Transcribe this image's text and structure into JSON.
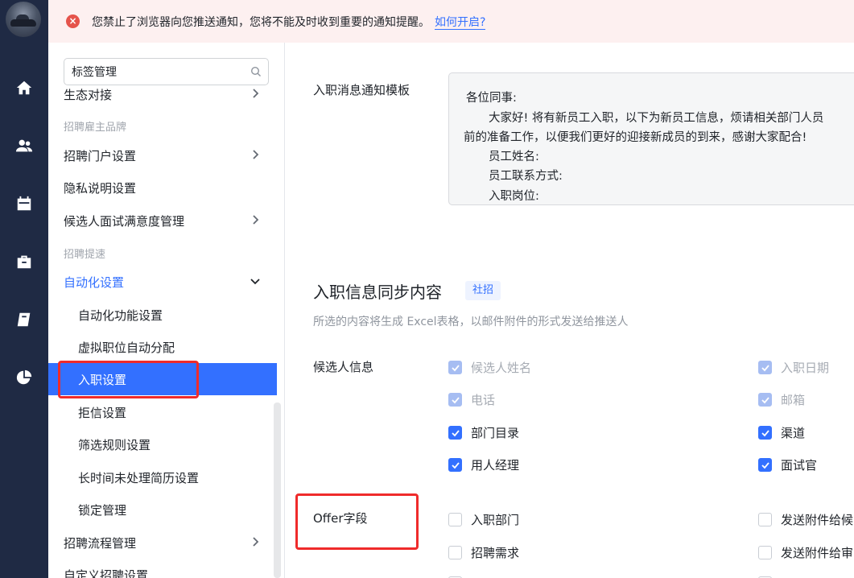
{
  "banner": {
    "message": "您禁止了浏览器向您推送通知，您将不能及时收到重要的通知提醒。",
    "link": "如何开启?"
  },
  "rail": {
    "icons": [
      "home-icon",
      "users-icon",
      "calendar-icon",
      "briefcase-icon",
      "book-icon",
      "pie-chart-icon"
    ]
  },
  "sidebar": {
    "search_value": "标签管理",
    "items": [
      {
        "label": "生态对接"
      },
      {
        "label": "招聘雇主品牌"
      },
      {
        "label": "招聘门户设置"
      },
      {
        "label": "隐私说明设置"
      },
      {
        "label": "候选人面试满意度管理"
      },
      {
        "label": "招聘提速"
      },
      {
        "label": "自动化设置"
      },
      {
        "label": "自动化功能设置"
      },
      {
        "label": "虚拟职位自动分配"
      },
      {
        "label": "入职设置"
      },
      {
        "label": "拒信设置"
      },
      {
        "label": "筛选规则设置"
      },
      {
        "label": "长时间未处理简历设置"
      },
      {
        "label": "锁定管理"
      },
      {
        "label": "招聘流程管理"
      },
      {
        "label": "自定义招聘设置"
      }
    ]
  },
  "main": {
    "template_label": "入职消息通知模板",
    "template_lines": [
      "各位同事:",
      "大家好! 将有新员工入职，以下为新员工信息，烦请相关部门人员",
      "前的准备工作，以便我们更好的迎接新成员的到来，感谢大家配合!",
      "员工姓名:",
      "员工联系方式:",
      "入职岗位:"
    ],
    "section_title": "入职信息同步内容",
    "section_tag": "社招",
    "section_desc": "所选的内容将生成 Excel表格，以邮件附件的形式发送给推送人",
    "candidate_label": "候选人信息",
    "candidate_fields": [
      {
        "label": "候选人姓名",
        "state": "disabled"
      },
      {
        "label": "入职日期",
        "state": "disabled"
      },
      {
        "label": "电话",
        "state": "disabled"
      },
      {
        "label": "邮箱",
        "state": "disabled"
      },
      {
        "label": "部门目录",
        "state": "checked"
      },
      {
        "label": "渠道",
        "state": "checked"
      },
      {
        "label": "用人经理",
        "state": "checked"
      },
      {
        "label": "面试官",
        "state": "checked"
      }
    ],
    "offer_label": "Offer字段",
    "offer_fields": [
      {
        "label": "入职部门",
        "state": "unchecked"
      },
      {
        "label": "发送附件给候",
        "state": "unchecked"
      },
      {
        "label": "招聘需求",
        "state": "unchecked"
      },
      {
        "label": "发送附件给审",
        "state": "unchecked"
      }
    ]
  },
  "colors": {
    "accent": "#3370ff",
    "rail": "#1f2a44",
    "highlight": "#ef2b2b"
  }
}
